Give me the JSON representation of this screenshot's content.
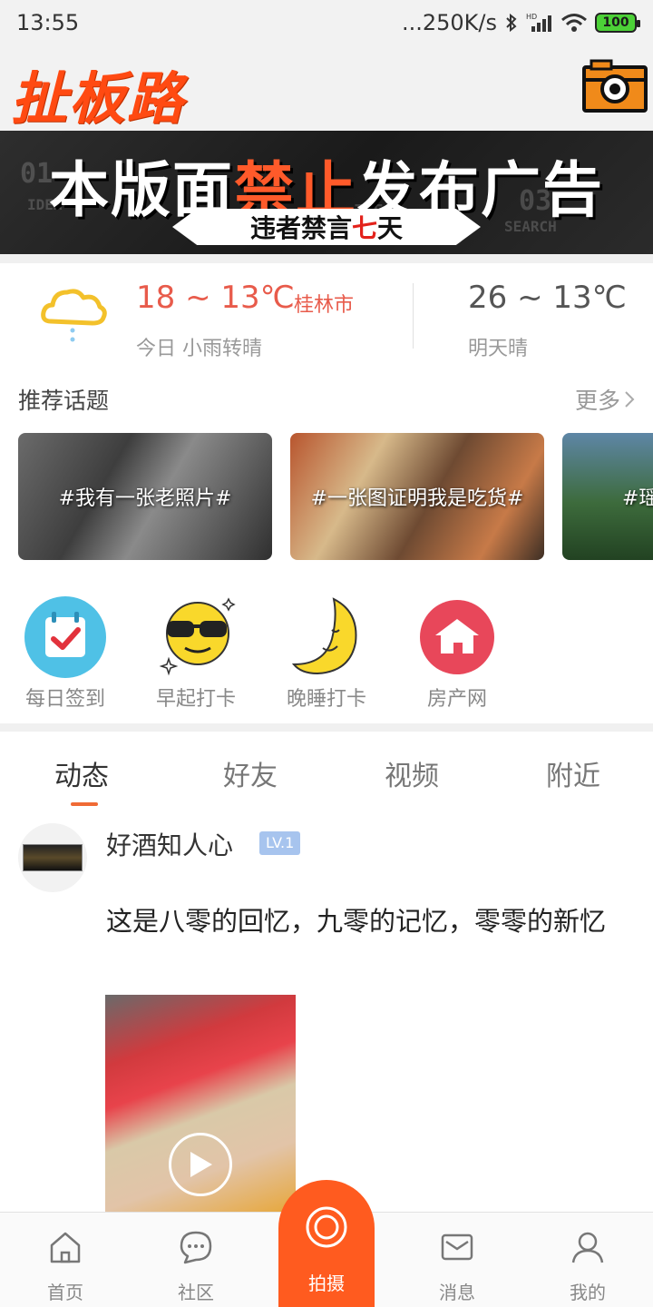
{
  "status_bar": {
    "time": "13:55",
    "network_speed": "...250K/s",
    "battery": "100",
    "icons": [
      "bluetooth-icon",
      "signal-icon",
      "wifi-icon",
      "battery-icon"
    ]
  },
  "header": {
    "logo_text": "扯板路",
    "camera_icon": "camera-icon"
  },
  "banner": {
    "title_pre": "本版面",
    "title_highlight": "禁止",
    "title_post": "发布广告",
    "subtitle_pre": "违者禁言",
    "subtitle_highlight": "七",
    "subtitle_post": "天",
    "deco_1": "01",
    "deco_2": "IDEA",
    "deco_3": "IDEA",
    "deco_4": "03",
    "deco_5": "SEARCH"
  },
  "weather": {
    "icon": "rain-cloud-icon",
    "today_temp": "18 ~ 13℃",
    "city": "桂林市",
    "today_desc": "今日 小雨转晴",
    "tomorrow_temp": "26 ~ 13℃",
    "tomorrow_desc": "明天晴"
  },
  "topics": {
    "title": "推荐话题",
    "more": "更多",
    "cards": [
      {
        "label": "#我有一张老照片#"
      },
      {
        "label": "#一张图证明我是吃货#"
      },
      {
        "label": "#瑶"
      }
    ]
  },
  "shortcuts": [
    {
      "label": "每日签到",
      "icon": "calendar-check-icon"
    },
    {
      "label": "早起打卡",
      "icon": "sunglasses-smiley-icon"
    },
    {
      "label": "晚睡打卡",
      "icon": "moon-icon"
    },
    {
      "label": "房产网",
      "icon": "house-icon"
    }
  ],
  "tabs": [
    {
      "label": "动态",
      "active": true
    },
    {
      "label": "好友",
      "active": false
    },
    {
      "label": "视频",
      "active": false
    },
    {
      "label": "附近",
      "active": false
    }
  ],
  "post": {
    "username": "好酒知人心",
    "level": "LV.1",
    "text": "这是八零的回忆，九零的记忆，零零的新忆"
  },
  "bottom_nav": {
    "items": [
      {
        "label": "首页",
        "icon": "home-icon"
      },
      {
        "label": "社区",
        "icon": "chat-bubble-icon"
      },
      {
        "label": "拍摄",
        "icon": "record-icon"
      },
      {
        "label": "消息",
        "icon": "mail-icon"
      },
      {
        "label": "我的",
        "icon": "user-icon"
      }
    ]
  },
  "colors": {
    "accent": "#ff5b1f",
    "logo": "#ff4a12",
    "weather_today": "#e85b4b",
    "tab_indicator": "#f06a35",
    "level_badge": "#a7c4ee"
  }
}
